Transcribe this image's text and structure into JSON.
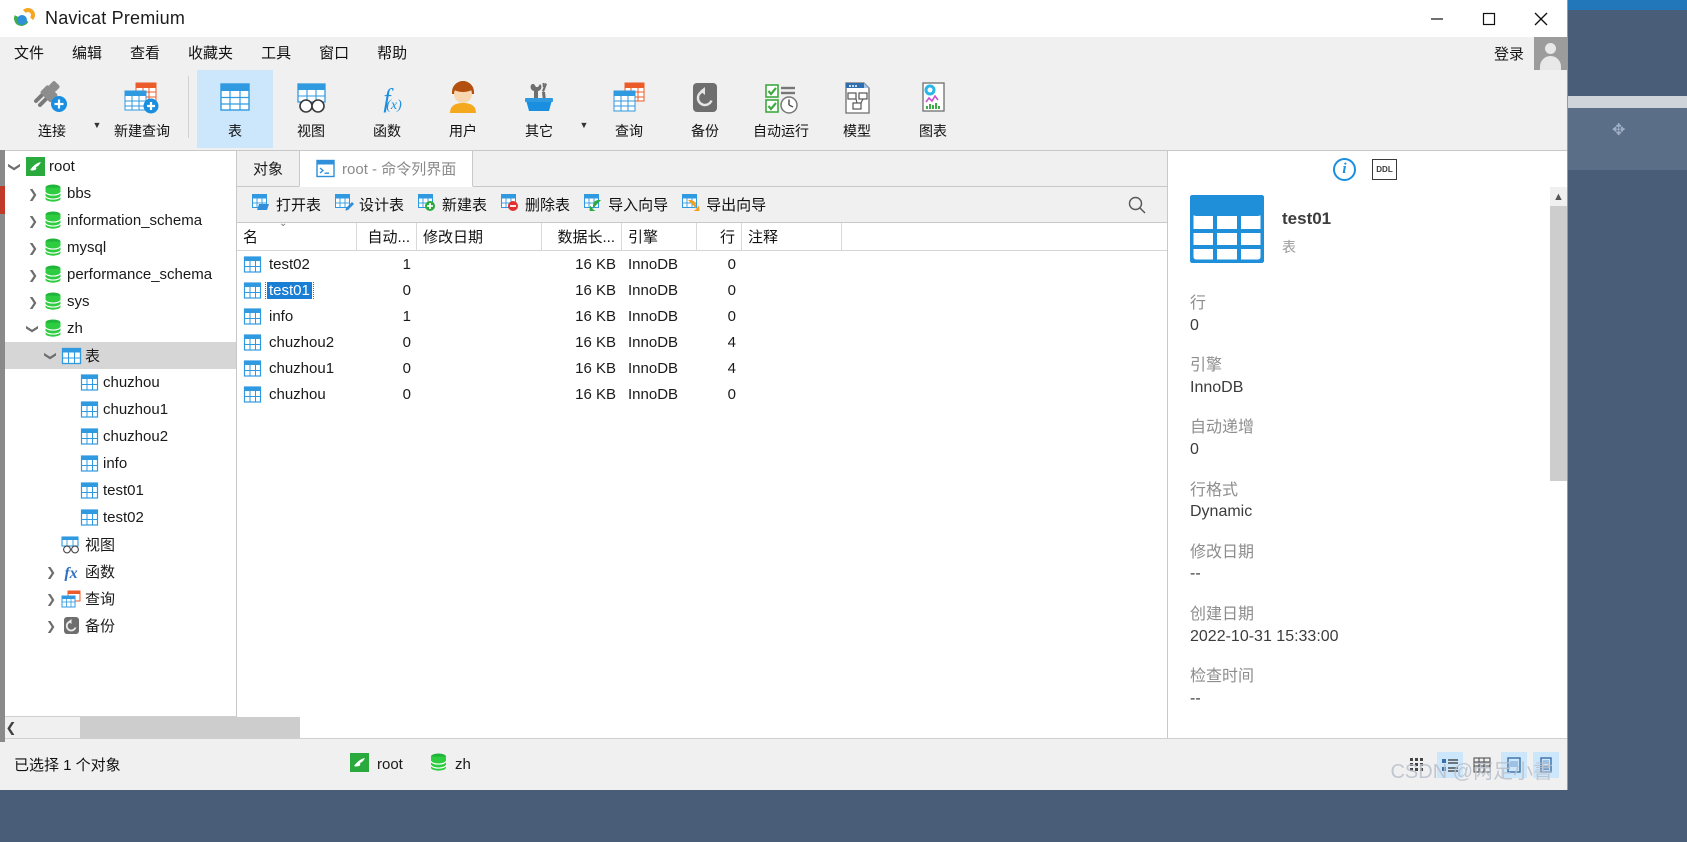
{
  "window": {
    "title": "Navicat Premium",
    "controls": {
      "minimize": "minimize-icon",
      "maximize": "maximize-icon",
      "close": "close-icon"
    }
  },
  "menubar": {
    "items": [
      "文件",
      "编辑",
      "查看",
      "收藏夹",
      "工具",
      "窗口",
      "帮助"
    ],
    "login_label": "登录"
  },
  "toolbar": {
    "items": [
      {
        "label": "连接",
        "icon": "connection-icon",
        "selected": false,
        "dropdown": true
      },
      {
        "label": "新建查询",
        "icon": "new-query-icon",
        "selected": false,
        "dropdown": false
      },
      {
        "label": "表",
        "icon": "table-icon",
        "selected": true,
        "dropdown": false
      },
      {
        "label": "视图",
        "icon": "view-icon",
        "selected": false,
        "dropdown": false
      },
      {
        "label": "函数",
        "icon": "function-icon",
        "selected": false,
        "dropdown": false
      },
      {
        "label": "用户",
        "icon": "user-icon",
        "selected": false,
        "dropdown": false
      },
      {
        "label": "其它",
        "icon": "others-icon",
        "selected": false,
        "dropdown": true
      },
      {
        "label": "查询",
        "icon": "query-icon",
        "selected": false,
        "dropdown": false
      },
      {
        "label": "备份",
        "icon": "backup-icon",
        "selected": false,
        "dropdown": false
      },
      {
        "label": "自动运行",
        "icon": "automation-icon",
        "selected": false,
        "dropdown": false
      },
      {
        "label": "模型",
        "icon": "model-icon",
        "selected": false,
        "dropdown": false
      },
      {
        "label": "图表",
        "icon": "chart-icon",
        "selected": false,
        "dropdown": false
      }
    ]
  },
  "sidebar": {
    "nodes": [
      {
        "label": "root",
        "indent": 0,
        "arrow": "down",
        "icon": "connection-mysql-icon",
        "selected": false
      },
      {
        "label": "bbs",
        "indent": 1,
        "arrow": "right",
        "icon": "database-icon",
        "selected": false
      },
      {
        "label": "information_schema",
        "indent": 1,
        "arrow": "right",
        "icon": "database-icon",
        "selected": false
      },
      {
        "label": "mysql",
        "indent": 1,
        "arrow": "right",
        "icon": "database-icon",
        "selected": false
      },
      {
        "label": "performance_schema",
        "indent": 1,
        "arrow": "right",
        "icon": "database-icon",
        "selected": false
      },
      {
        "label": "sys",
        "indent": 1,
        "arrow": "right",
        "icon": "database-icon",
        "selected": false
      },
      {
        "label": "zh",
        "indent": 1,
        "arrow": "down",
        "icon": "database-icon",
        "selected": false
      },
      {
        "label": "表",
        "indent": 2,
        "arrow": "down",
        "icon": "table-folder-icon",
        "selected": true
      },
      {
        "label": "chuzhou",
        "indent": 3,
        "arrow": "none",
        "icon": "table-icon",
        "selected": false
      },
      {
        "label": "chuzhou1",
        "indent": 3,
        "arrow": "none",
        "icon": "table-icon",
        "selected": false
      },
      {
        "label": "chuzhou2",
        "indent": 3,
        "arrow": "none",
        "icon": "table-icon",
        "selected": false
      },
      {
        "label": "info",
        "indent": 3,
        "arrow": "none",
        "icon": "table-icon",
        "selected": false
      },
      {
        "label": "test01",
        "indent": 3,
        "arrow": "none",
        "icon": "table-icon",
        "selected": false
      },
      {
        "label": "test02",
        "indent": 3,
        "arrow": "none",
        "icon": "table-icon",
        "selected": false
      },
      {
        "label": "视图",
        "indent": 2,
        "arrow": "none",
        "icon": "view-folder-icon",
        "selected": false
      },
      {
        "label": "函数",
        "indent": 2,
        "arrow": "right",
        "icon": "function-folder-icon",
        "selected": false
      },
      {
        "label": "查询",
        "indent": 2,
        "arrow": "right",
        "icon": "query-folder-icon",
        "selected": false
      },
      {
        "label": "备份",
        "indent": 2,
        "arrow": "right",
        "icon": "backup-folder-icon",
        "selected": false
      }
    ]
  },
  "tabs": {
    "object_tab": "对象",
    "command_tab": "root - 命令列界面"
  },
  "objectbar": {
    "buttons": [
      {
        "label": "打开表",
        "icon": "open-table-icon"
      },
      {
        "label": "设计表",
        "icon": "design-table-icon"
      },
      {
        "label": "新建表",
        "icon": "new-table-icon"
      },
      {
        "label": "删除表",
        "icon": "delete-table-icon"
      },
      {
        "label": "导入向导",
        "icon": "import-wizard-icon"
      },
      {
        "label": "导出向导",
        "icon": "export-wizard-icon"
      }
    ],
    "search_icon": "search-icon"
  },
  "grid": {
    "columns": [
      "名",
      "自动...",
      "修改日期",
      "数据长...",
      "引擎",
      "行",
      "注释"
    ],
    "sorted_column": "名",
    "rows": [
      {
        "name": "test02",
        "auto": "1",
        "modified": "",
        "datalength": "16 KB",
        "engine": "InnoDB",
        "rows": "0",
        "comment": "",
        "selected": false
      },
      {
        "name": "test01",
        "auto": "0",
        "modified": "",
        "datalength": "16 KB",
        "engine": "InnoDB",
        "rows": "0",
        "comment": "",
        "selected": true
      },
      {
        "name": "info",
        "auto": "1",
        "modified": "",
        "datalength": "16 KB",
        "engine": "InnoDB",
        "rows": "0",
        "comment": "",
        "selected": false
      },
      {
        "name": "chuzhou2",
        "auto": "0",
        "modified": "",
        "datalength": "16 KB",
        "engine": "InnoDB",
        "rows": "4",
        "comment": "",
        "selected": false
      },
      {
        "name": "chuzhou1",
        "auto": "0",
        "modified": "",
        "datalength": "16 KB",
        "engine": "InnoDB",
        "rows": "4",
        "comment": "",
        "selected": false
      },
      {
        "name": "chuzhou",
        "auto": "0",
        "modified": "",
        "datalength": "16 KB",
        "engine": "InnoDB",
        "rows": "0",
        "comment": "",
        "selected": false
      }
    ]
  },
  "rightpanel": {
    "info_icon": "info-icon",
    "ddl_icon": "ddl-icon",
    "object_name": "test01",
    "object_type": "表",
    "properties": [
      {
        "label": "行",
        "value": "0"
      },
      {
        "label": "引擎",
        "value": "InnoDB"
      },
      {
        "label": "自动递增",
        "value": "0"
      },
      {
        "label": "行格式",
        "value": "Dynamic"
      },
      {
        "label": "修改日期",
        "value": "--"
      },
      {
        "label": "创建日期",
        "value": "2022-10-31 15:33:00"
      },
      {
        "label": "检查时间",
        "value": "--"
      }
    ]
  },
  "statusbar": {
    "message": "已选择 1 个对象",
    "connection": "root",
    "database": "zh",
    "view_modes": [
      {
        "name": "grid-view",
        "active": false
      },
      {
        "name": "list-view",
        "active": true
      },
      {
        "name": "detail-view",
        "active": false
      },
      {
        "name": "big-icon-view",
        "active": true
      },
      {
        "name": "small-icon-view",
        "active": true
      }
    ],
    "watermark": "CSDN @两足小書"
  },
  "colors": {
    "accent": "#2f8fd8",
    "selection": "#1a7fd4",
    "toolbar_selected": "#cce6fb",
    "green_db": "#22b14c",
    "chrome": "#f0f0f0"
  }
}
